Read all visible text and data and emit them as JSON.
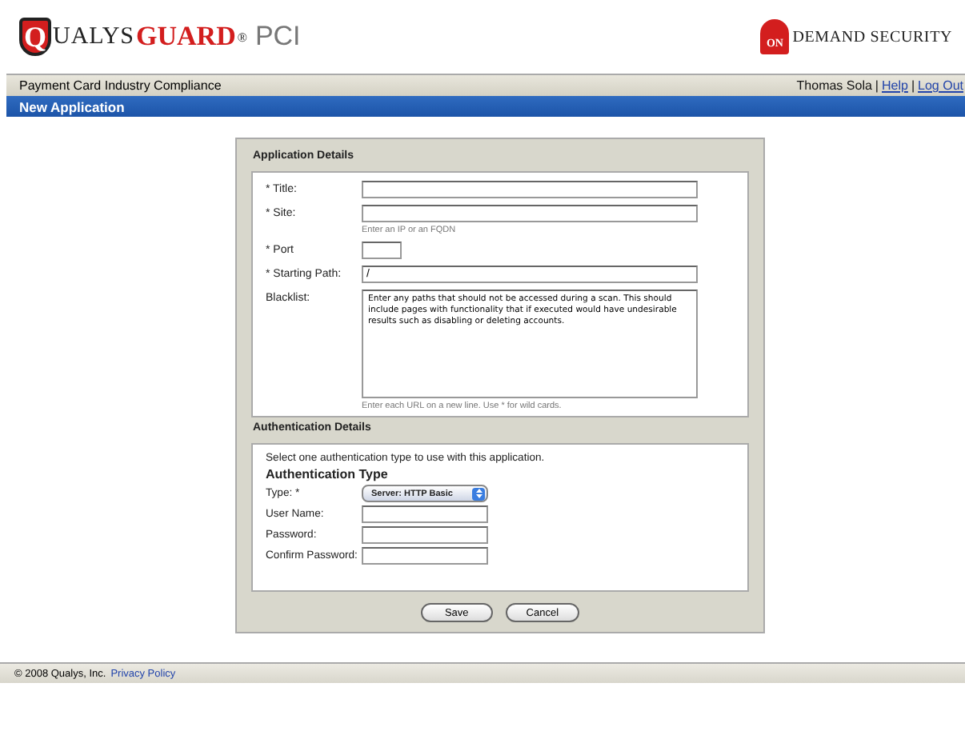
{
  "header": {
    "logo": {
      "shield_letter": "Q",
      "name": "UALYS",
      "accent": "GUARD",
      "mark": "®",
      "product": "PCI"
    },
    "partner_logo": {
      "lock_text": "ON",
      "name": "DEMAND SECURITY"
    }
  },
  "nav_bar": {
    "title": "Payment Card Industry Compliance",
    "user": "Thomas Sola",
    "separators": [
      "|",
      "|"
    ],
    "links": [
      "Help",
      "Log Out"
    ]
  },
  "page_title": "New Application",
  "application_details": {
    "title": "Application Details",
    "fields": [
      {
        "kind": "text",
        "label": "* Title:"
      },
      {
        "kind": "text",
        "label": "* Site:",
        "hint": "Enter an IP or an FQDN"
      },
      {
        "kind": "short-text",
        "label": "* Port"
      },
      {
        "kind": "text",
        "label": "* Starting Path:",
        "value": "/"
      },
      {
        "kind": "textarea",
        "label": "Blacklist:",
        "value": "Enter any paths that should not be accessed during a scan. This should include pages with functionality that if executed would have undesirable results such as disabling or deleting accounts.",
        "hint": "Enter each URL on a new line. Use * for wild cards."
      }
    ]
  },
  "authentication_details": {
    "title": "Authentication Details",
    "intro": "Select one authentication type to use with this application.",
    "heading": "Authentication Type",
    "fields": [
      {
        "kind": "select",
        "label": "Type: *",
        "value": "Server: HTTP Basic"
      },
      {
        "kind": "text",
        "label": "User Name:"
      },
      {
        "kind": "text",
        "label": "Password:"
      },
      {
        "kind": "text",
        "label": "Confirm Password:"
      }
    ]
  },
  "buttons": [
    "Save",
    "Cancel"
  ],
  "footer": {
    "copyright": "© 2008 Qualys, Inc.",
    "link": "Privacy Policy"
  }
}
